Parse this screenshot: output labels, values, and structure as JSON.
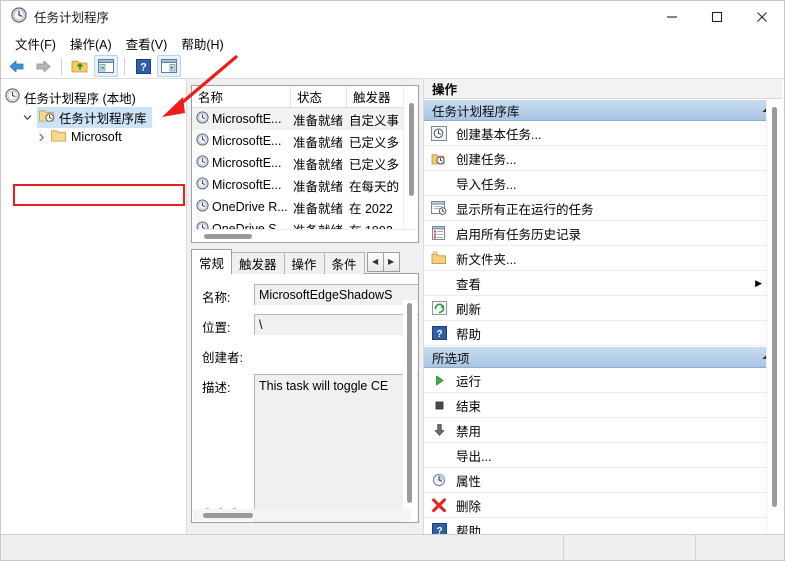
{
  "window": {
    "title": "任务计划程序",
    "app_icon": "clock-icon",
    "controls": {
      "minimize": "minimize-icon",
      "maximize": "maximize-icon",
      "close": "close-icon"
    }
  },
  "menubar": {
    "items": [
      {
        "label": "文件(F)",
        "name": "menu-file"
      },
      {
        "label": "操作(A)",
        "name": "menu-action"
      },
      {
        "label": "查看(V)",
        "name": "menu-view"
      },
      {
        "label": "帮助(H)",
        "name": "menu-help"
      }
    ]
  },
  "toolbar": {
    "buttons": [
      {
        "name": "back-button",
        "icon": "arrow-left-icon"
      },
      {
        "name": "forward-button",
        "icon": "arrow-right-icon"
      },
      {
        "name": "up-folder-button",
        "icon": "folder-up-icon"
      },
      {
        "name": "show-hide-console-tree-button",
        "icon": "console-tree-icon"
      },
      {
        "name": "help-button",
        "icon": "question-mark-icon"
      },
      {
        "name": "show-action-pane-button",
        "icon": "action-pane-icon"
      }
    ]
  },
  "tree": {
    "nodes": [
      {
        "label": "任务计划程序 (本地)",
        "icon": "clock-icon",
        "level": 0,
        "selected": false,
        "expander": ""
      },
      {
        "label": "任务计划程序库",
        "icon": "folder-clock-icon",
        "level": 1,
        "selected": true,
        "expander": "v"
      },
      {
        "label": "Microsoft",
        "icon": "folder-icon",
        "level": 2,
        "selected": false,
        "expander": ">"
      }
    ]
  },
  "annotation": {
    "highlight_target": "任务计划程序库",
    "arrow_color": "#ee1c1c",
    "box_color": "#ee1c1c"
  },
  "task_list": {
    "columns": [
      {
        "label": "名称",
        "name": "column-name"
      },
      {
        "label": "状态",
        "name": "column-status"
      },
      {
        "label": "触发器",
        "name": "column-trigger"
      }
    ],
    "rows": [
      {
        "name": "MicrosoftE...",
        "status": "准备就绪",
        "trigger": "自定义事",
        "selected": true
      },
      {
        "name": "MicrosoftE...",
        "status": "准备就绪",
        "trigger": "已定义多",
        "selected": false
      },
      {
        "name": "MicrosoftE...",
        "status": "准备就绪",
        "trigger": "已定义多",
        "selected": false
      },
      {
        "name": "MicrosoftE...",
        "status": "准备就绪",
        "trigger": "在每天的",
        "selected": false
      },
      {
        "name": "OneDrive R...",
        "status": "准备就绪",
        "trigger": "在 2022",
        "selected": false
      },
      {
        "name": "OneDrive S...",
        "status": "准备就绪",
        "trigger": "在 1992",
        "selected": false
      }
    ]
  },
  "details": {
    "tabs": [
      {
        "label": "常规",
        "active": true
      },
      {
        "label": "触发器",
        "active": false
      },
      {
        "label": "操作",
        "active": false
      },
      {
        "label": "条件",
        "active": false
      }
    ],
    "tab_nav": {
      "prev": "◀",
      "next": "▶"
    },
    "fields": [
      {
        "label": "名称:",
        "value": "MicrosoftEdgeShadowS",
        "style": "box"
      },
      {
        "label": "位置:",
        "value": "\\",
        "style": "box"
      },
      {
        "label": "创建者:",
        "value": "",
        "style": "empty"
      }
    ],
    "description": {
      "label": "描述:",
      "value": "This task will toggle CE"
    },
    "security_section": "安全选项"
  },
  "actions": {
    "title": "操作",
    "groups": [
      {
        "header": "任务计划程序库",
        "collapse_icon": "chevron-up-icon",
        "items": [
          {
            "label": "创建基本任务...",
            "icon": "create-basic-task-icon",
            "name": "action-create-basic-task"
          },
          {
            "label": "创建任务...",
            "icon": "create-task-icon",
            "name": "action-create-task"
          },
          {
            "label": "导入任务...",
            "icon": "",
            "name": "action-import-task"
          },
          {
            "label": "显示所有正在运行的任务",
            "icon": "running-tasks-icon",
            "name": "action-show-running-tasks"
          },
          {
            "label": "启用所有任务历史记录",
            "icon": "task-history-icon",
            "name": "action-enable-task-history"
          },
          {
            "label": "新文件夹...",
            "icon": "new-folder-icon",
            "name": "action-new-folder"
          },
          {
            "label": "查看",
            "icon": "",
            "name": "action-view",
            "submenu": "▶"
          },
          {
            "label": "刷新",
            "icon": "refresh-icon",
            "name": "action-refresh"
          },
          {
            "label": "帮助",
            "icon": "question-mark-icon",
            "name": "action-help"
          }
        ]
      },
      {
        "header": "所选项",
        "collapse_icon": "chevron-up-icon",
        "items": [
          {
            "label": "运行",
            "icon": "play-icon",
            "name": "action-run"
          },
          {
            "label": "结束",
            "icon": "stop-icon",
            "name": "action-end"
          },
          {
            "label": "禁用",
            "icon": "disable-arrow-icon",
            "name": "action-disable"
          },
          {
            "label": "导出...",
            "icon": "",
            "name": "action-export"
          },
          {
            "label": "属性",
            "icon": "properties-clock-icon",
            "name": "action-properties"
          },
          {
            "label": "删除",
            "icon": "delete-x-icon",
            "name": "action-delete"
          },
          {
            "label": "帮助",
            "icon": "question-mark-icon",
            "name": "action-help-selected"
          }
        ]
      }
    ]
  },
  "statusbar": {
    "segments": [
      "",
      "",
      ""
    ]
  }
}
